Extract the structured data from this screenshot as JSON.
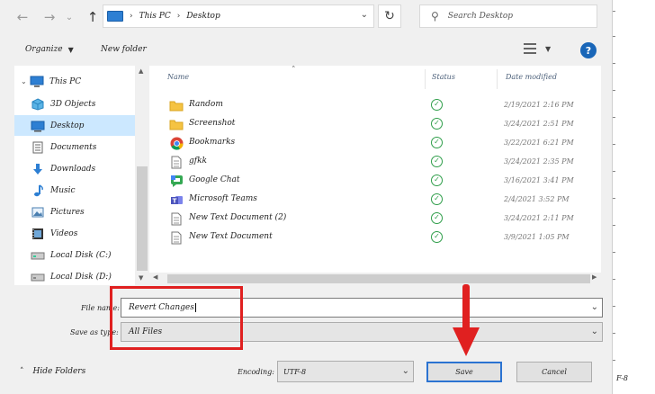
{
  "address": {
    "crumbs": [
      "This PC",
      "Desktop"
    ]
  },
  "search": {
    "placeholder": "Search Desktop"
  },
  "toolbar": {
    "organize_label": "Organize",
    "new_folder_label": "New folder",
    "help_label": "?"
  },
  "nav_pane": {
    "items": [
      {
        "label": "This PC",
        "icon": "computer-icon",
        "indent": 0,
        "selected": false
      },
      {
        "label": "3D Objects",
        "icon": "cube-icon",
        "indent": 1,
        "selected": false
      },
      {
        "label": "Desktop",
        "icon": "desktop-icon",
        "indent": 1,
        "selected": true
      },
      {
        "label": "Documents",
        "icon": "documents-icon",
        "indent": 1,
        "selected": false
      },
      {
        "label": "Downloads",
        "icon": "download-icon",
        "indent": 1,
        "selected": false
      },
      {
        "label": "Music",
        "icon": "music-icon",
        "indent": 1,
        "selected": false
      },
      {
        "label": "Pictures",
        "icon": "pictures-icon",
        "indent": 1,
        "selected": false
      },
      {
        "label": "Videos",
        "icon": "video-icon",
        "indent": 1,
        "selected": false
      },
      {
        "label": "Local Disk (C:)",
        "icon": "drive-icon",
        "indent": 1,
        "selected": false
      },
      {
        "label": "Local Disk (D:)",
        "icon": "drive-icon",
        "indent": 1,
        "selected": false
      }
    ]
  },
  "file_list": {
    "columns": {
      "name": "Name",
      "status": "Status",
      "date": "Date modified"
    },
    "files": [
      {
        "name": "Random",
        "icon": "folder-icon",
        "date": "2/19/2021 2:16 PM"
      },
      {
        "name": "Screenshot",
        "icon": "folder-icon",
        "date": "3/24/2021 2:51 PM"
      },
      {
        "name": "Bookmarks",
        "icon": "chrome-icon",
        "date": "3/22/2021 6:21 PM"
      },
      {
        "name": "gfkk",
        "icon": "text-file-icon",
        "date": "3/24/2021 2:35 PM"
      },
      {
        "name": "Google Chat",
        "icon": "google-chat-icon",
        "date": "3/16/2021 3:41 PM"
      },
      {
        "name": "Microsoft Teams",
        "icon": "teams-icon",
        "date": "2/4/2021 3:52 PM"
      },
      {
        "name": "New Text Document (2)",
        "icon": "text-file-icon",
        "date": "3/24/2021 2:11 PM"
      },
      {
        "name": "New Text Document",
        "icon": "text-file-icon",
        "date": "3/9/2021 1:05 PM"
      }
    ]
  },
  "form": {
    "file_name_label": "File name:",
    "file_name_value": "Revert Changes",
    "save_as_type_label": "Save as type:",
    "save_as_type_value": "All Files",
    "encoding_label": "Encoding:",
    "encoding_value": "UTF-8"
  },
  "footer": {
    "hide_folders_label": "Hide Folders",
    "save_label": "Save",
    "cancel_label": "Cancel"
  },
  "background_tail_text": "F-8",
  "colors": {
    "selected_bg": "#cce8ff",
    "status_green": "#2f9e4a",
    "annotation_red": "#e02020",
    "accent_blue": "#2b73d1"
  }
}
